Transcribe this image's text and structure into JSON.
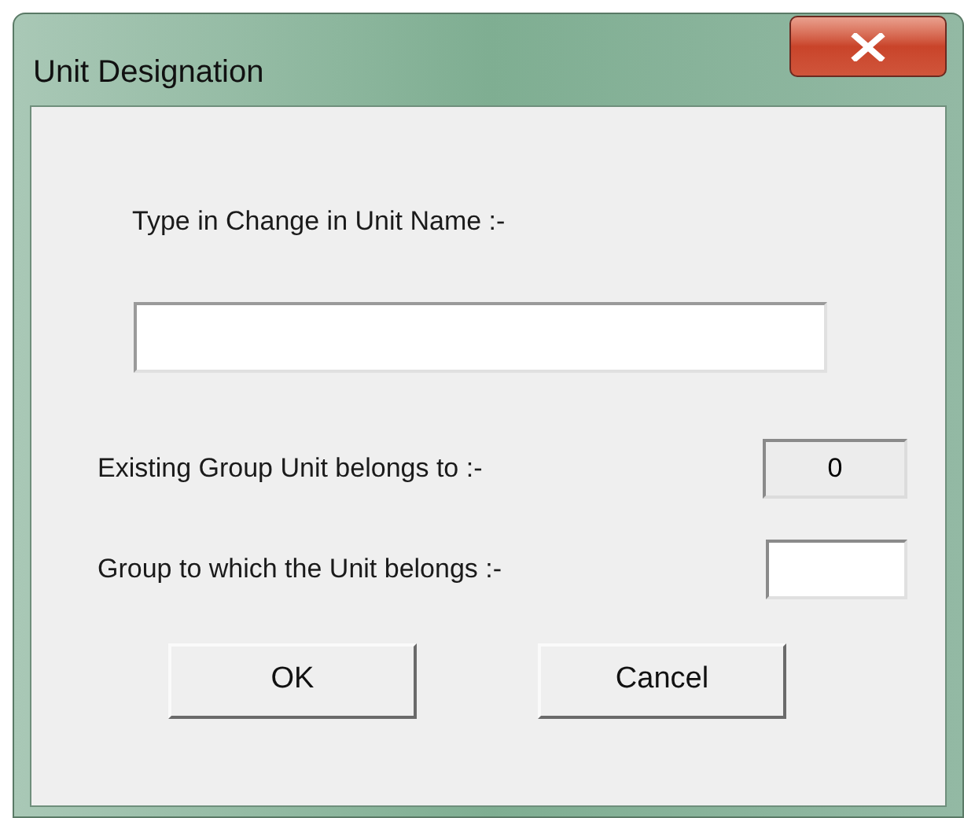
{
  "window": {
    "title": "Unit Designation"
  },
  "name_prompt": {
    "label": "Type in Change in Unit Name :-"
  },
  "existing_group": {
    "label": "Existing Group Unit belongs to :-",
    "value": "0"
  },
  "new_group": {
    "label": "Group to which the Unit belongs :-"
  },
  "buttons": [
    {
      "label": "OK"
    },
    {
      "label": "Cancel"
    }
  ]
}
